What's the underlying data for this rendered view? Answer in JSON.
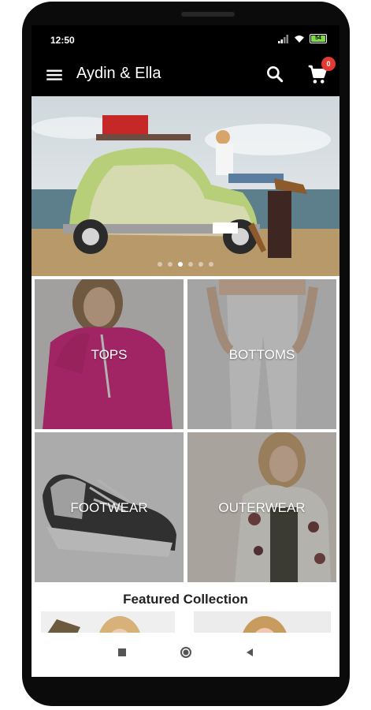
{
  "status_bar": {
    "time": "12:50",
    "battery": "54"
  },
  "app_bar": {
    "title": "Aydin & Ella",
    "cart_count": "0"
  },
  "banner": {
    "slides": 6,
    "active_slide": 3
  },
  "categories": [
    {
      "label": "TOPS"
    },
    {
      "label": "BOTTOMS"
    },
    {
      "label": "FOOTWEAR"
    },
    {
      "label": "OUTERWEAR"
    }
  ],
  "featured": {
    "title": "Featured Collection"
  },
  "icons": {
    "menu": "menu-icon",
    "search": "search-icon",
    "cart": "cart-icon",
    "back": "back-icon",
    "home": "home-icon",
    "recents": "recents-icon"
  },
  "colors": {
    "badge": "#e53935",
    "app_bar": "#000000",
    "battery": "#7ddc3f"
  }
}
